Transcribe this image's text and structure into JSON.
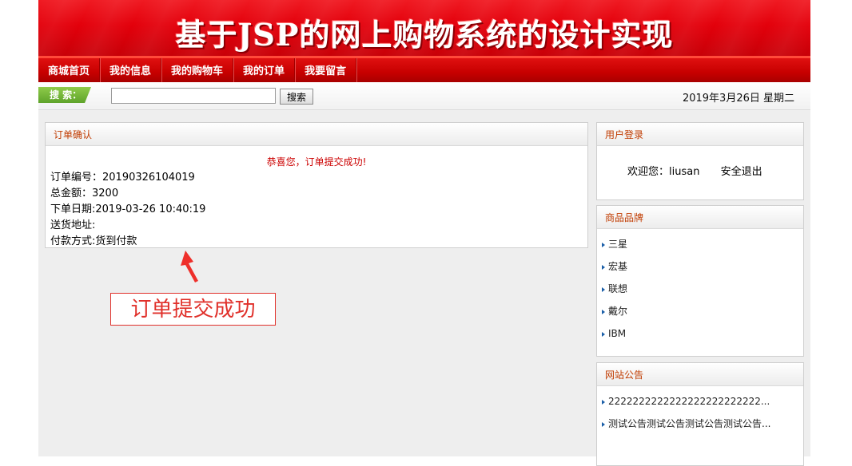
{
  "banner": {
    "title": "基于JSP的网上购物系统的设计实现"
  },
  "nav": {
    "items": [
      "商城首页",
      "我的信息",
      "我的购物车",
      "我的订单",
      "我要留言"
    ]
  },
  "search": {
    "label": "搜 索：",
    "input_value": "",
    "button_label": "搜索",
    "date": "2019年3月26日 星期二"
  },
  "order": {
    "title": "订单确认",
    "success_message": "恭喜您，订单提交成功!",
    "order_no": "订单编号：20190326104019",
    "total": "总金额：3200",
    "date": "下单日期:2019-03-26 10:40:19",
    "address": "送货地址:",
    "payment": "付款方式:货到付款"
  },
  "login": {
    "title": "用户登录",
    "welcome": "欢迎您：liusan",
    "logout": "安全退出"
  },
  "brands": {
    "title": "商品品牌",
    "items": [
      "三星",
      "宏基",
      "联想",
      "戴尔",
      "IBM"
    ]
  },
  "notices": {
    "title": "网站公告",
    "items": [
      "2222222222222222222222222...",
      "测试公告测试公告测试公告测试公告..."
    ]
  },
  "annotation": {
    "text": "订单提交成功"
  },
  "colors": {
    "banner_red": "#e3000b",
    "nav_red": "#c70000",
    "panel_title": "#c03b00",
    "success_red": "#cc0000",
    "annotation_red": "#e0302a",
    "search_green": "#6fb536"
  }
}
